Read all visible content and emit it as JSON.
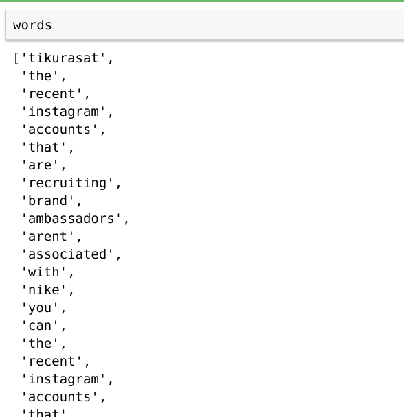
{
  "cell": {
    "input_code": "words"
  },
  "output": {
    "lines": [
      "['tikurasat',",
      " 'the',",
      " 'recent',",
      " 'instagram',",
      " 'accounts',",
      " 'that',",
      " 'are',",
      " 'recruiting',",
      " 'brand',",
      " 'ambassadors',",
      " 'arent',",
      " 'associated',",
      " 'with',",
      " 'nike',",
      " 'you',",
      " 'can',",
      " 'the',",
      " 'recent',",
      " 'instagram',",
      " 'accounts',",
      " 'that',"
    ]
  }
}
